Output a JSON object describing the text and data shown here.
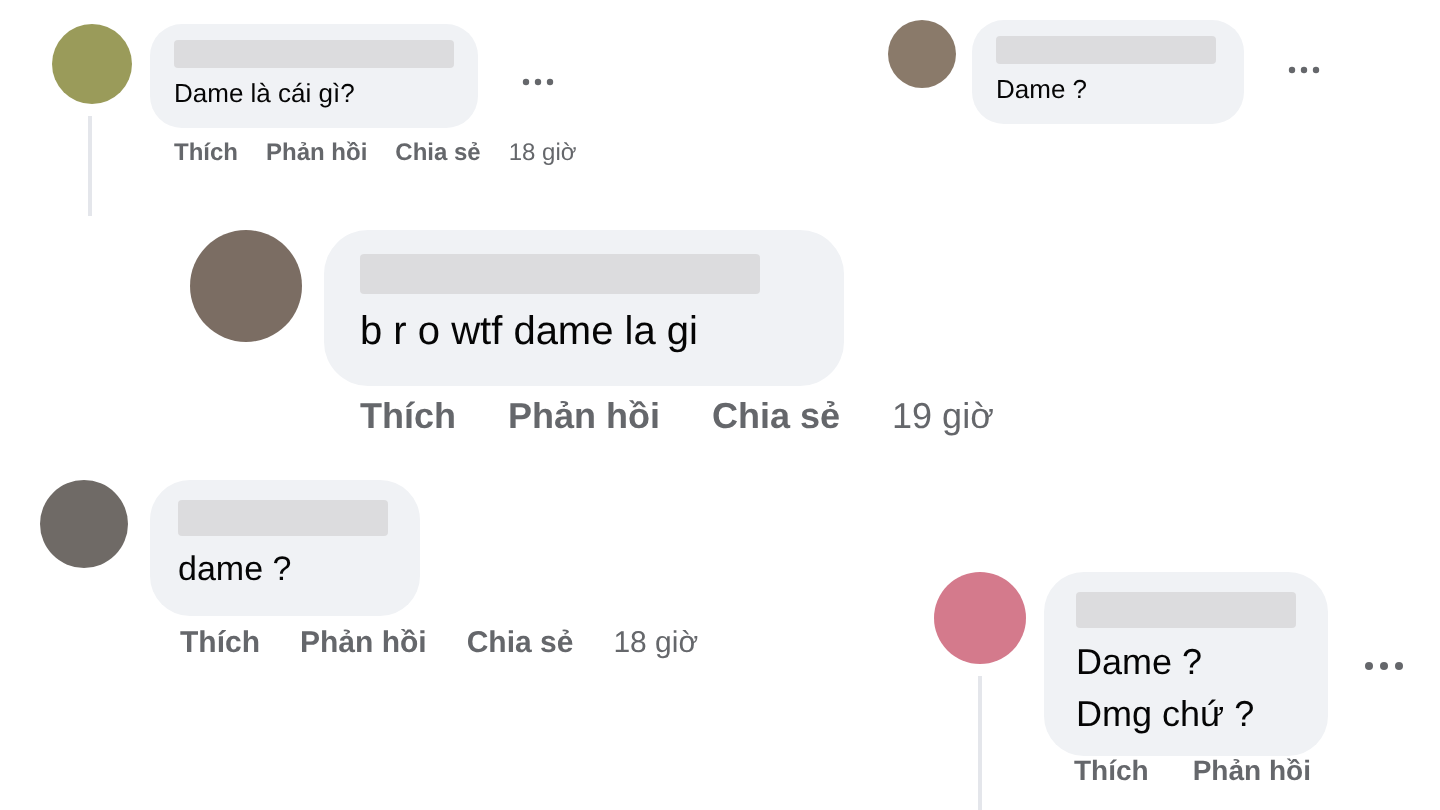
{
  "comments": [
    {
      "lines": [
        "Dame là cái gì?"
      ],
      "actions": [
        "Thích",
        "Phản hồi",
        "Chia sẻ"
      ],
      "time": "18 giờ"
    },
    {
      "lines": [
        "Dame ?"
      ]
    },
    {
      "lines": [
        "b r o wtf dame la gi"
      ],
      "actions": [
        "Thích",
        "Phản hồi",
        "Chia sẻ"
      ],
      "time": "19 giờ"
    },
    {
      "lines": [
        "dame ?"
      ],
      "actions": [
        "Thích",
        "Phản hồi",
        "Chia sẻ"
      ],
      "time": "18 giờ"
    },
    {
      "lines": [
        "Dame ?",
        "Dmg chứ ?"
      ],
      "actions": [
        "Thích",
        "Phản hồi"
      ]
    }
  ]
}
